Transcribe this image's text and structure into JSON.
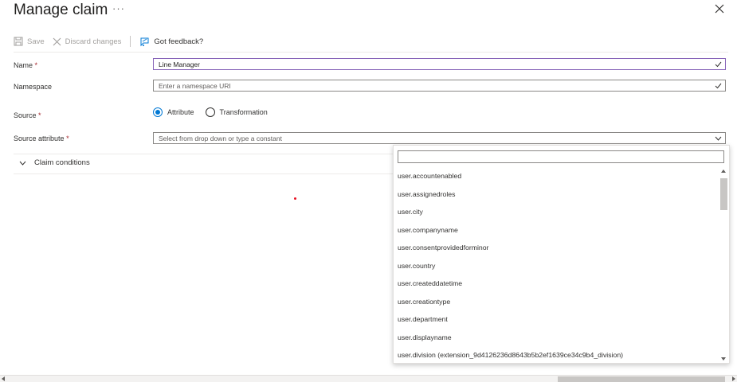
{
  "header": {
    "title": "Manage claim",
    "more_label": "···"
  },
  "toolbar": {
    "save_label": "Save",
    "discard_label": "Discard changes",
    "feedback_label": "Got feedback?"
  },
  "form": {
    "name": {
      "label": "Name",
      "required_mark": "*",
      "value": "Line Manager"
    },
    "namespace": {
      "label": "Namespace",
      "placeholder": "Enter a namespace URI"
    },
    "source": {
      "label": "Source",
      "required_mark": "*",
      "options": [
        {
          "label": "Attribute",
          "selected": true
        },
        {
          "label": "Transformation",
          "selected": false
        }
      ]
    },
    "source_attribute": {
      "label": "Source attribute",
      "required_mark": "*",
      "placeholder": "Select from drop down or type a constant"
    }
  },
  "claim_conditions": {
    "label": "Claim conditions"
  },
  "dropdown": {
    "search_value": "",
    "items": [
      "user.accountenabled",
      "user.assignedroles",
      "user.city",
      "user.companyname",
      "user.consentprovidedforminor",
      "user.country",
      "user.createddatetime",
      "user.creationtype",
      "user.department",
      "user.displayname",
      "user.division (extension_9d4126236d8643b5b2ef1639ce34c9b4_division)"
    ]
  },
  "colors": {
    "accent": "#0078d4",
    "focus_border": "#8764b8",
    "required": "#a4262c",
    "marker_dot": "#e81123"
  }
}
